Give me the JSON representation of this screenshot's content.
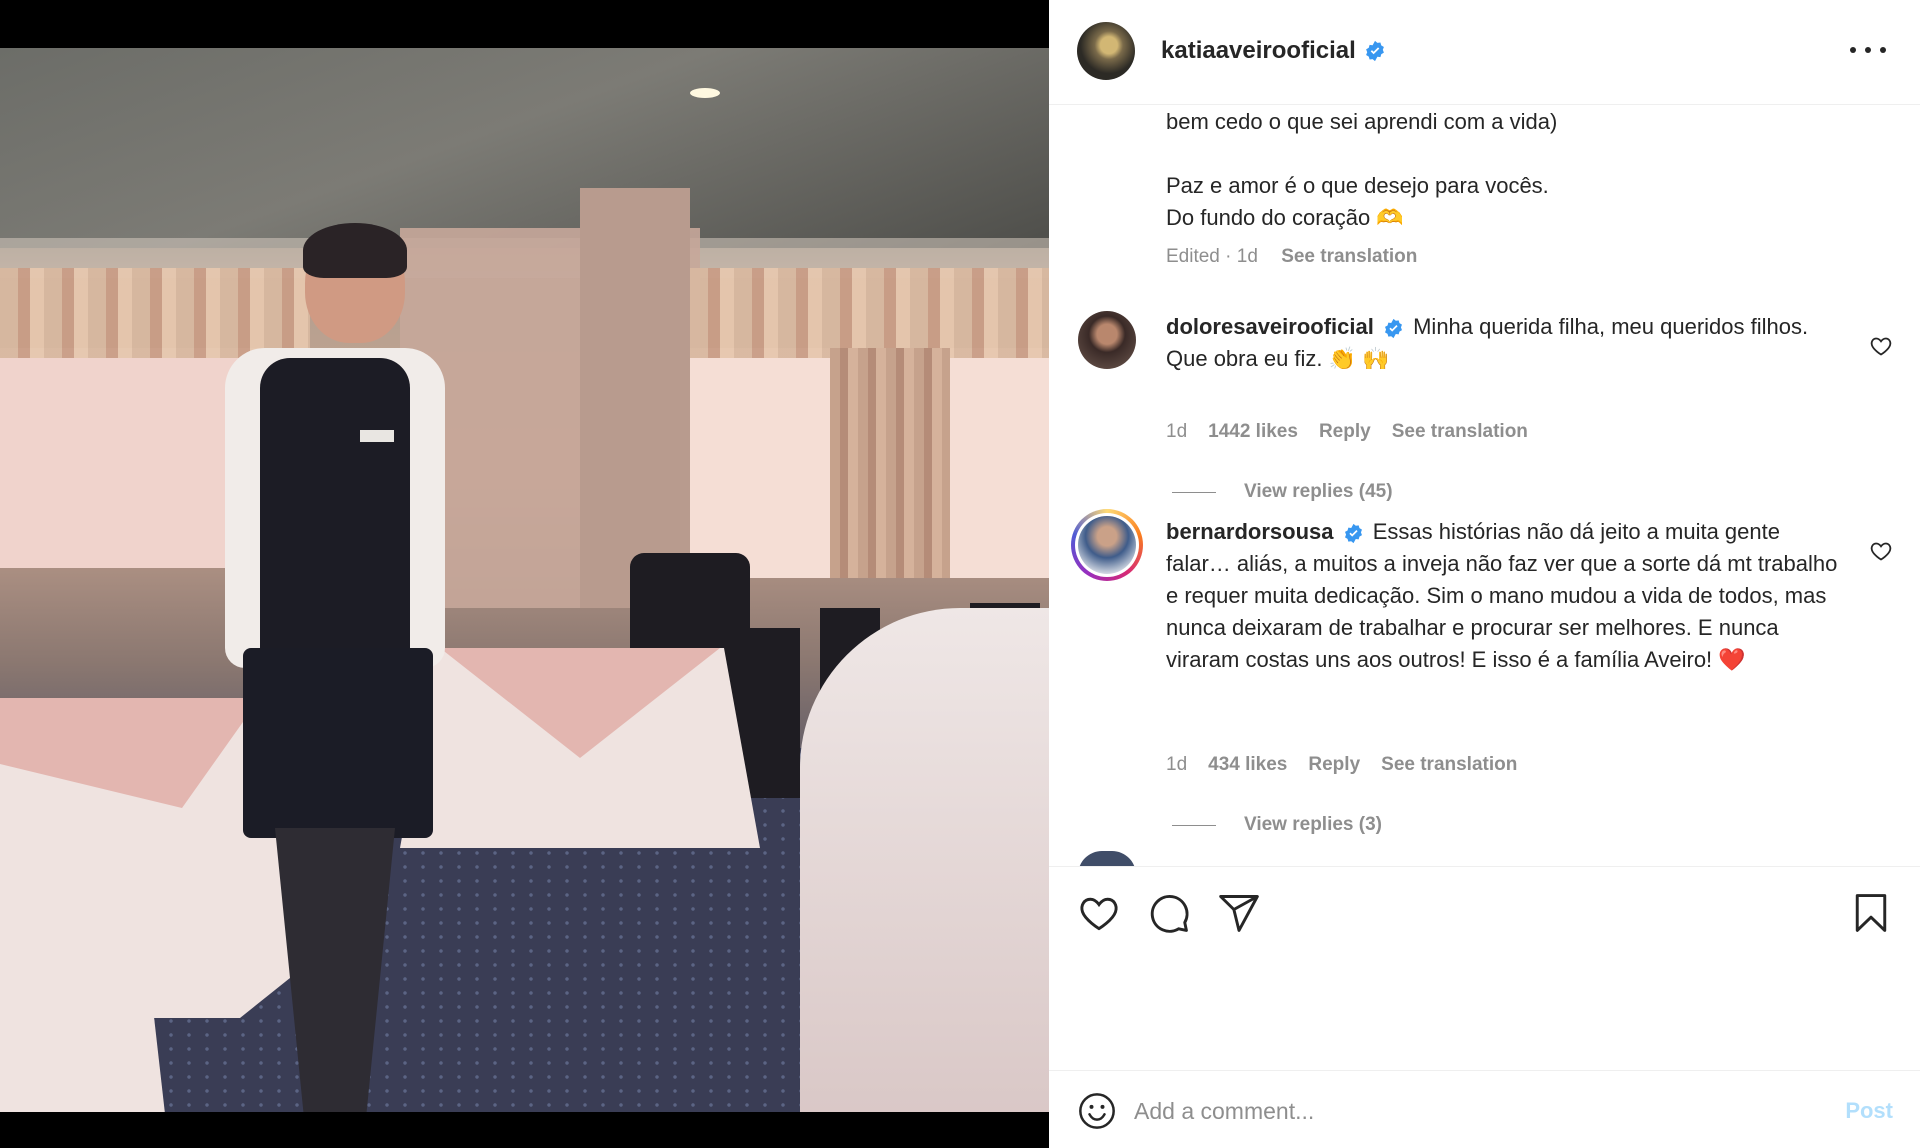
{
  "post": {
    "author": "katiaaveirooficial",
    "caption_lines": [
      "bem cedo o que sei aprendi com a vida)",
      "",
      "Paz e amor é o que desejo para vocês.",
      "Do fundo do coração 🫶"
    ],
    "caption_meta": "Edited · 1d",
    "see_translation": "See translation"
  },
  "comments": [
    {
      "username": "doloresaveirooficial",
      "text": "Minha querida filha, meu queridos filhos. Que obra eu fiz. 👏 🙌",
      "age": "1d",
      "likes": "1442 likes",
      "reply": "Reply",
      "translate": "See translation",
      "view_replies": "View replies (45)"
    },
    {
      "username": "bernardorsousa",
      "text": "Essas histórias não dá jeito a muita gente falar… aliás, a muitos a inveja não faz ver que a sorte dá mt trabalho e requer muita dedicação. Sim o mano mudou a vida de todos, mas nunca deixaram de trabalhar e procurar ser melhores. E nunca viraram costas uns aos outros! E isso é a família Aveiro! ❤️",
      "age": "1d",
      "likes": "434 likes",
      "reply": "Reply",
      "translate": "See translation",
      "view_replies": "View replies (3)"
    }
  ],
  "comment_box": {
    "placeholder": "Add a comment...",
    "post_label": "Post"
  },
  "icons": {
    "verified": "verified-badge-icon",
    "more": "more-options-icon",
    "like": "heart-icon",
    "comment": "comment-icon",
    "share": "share-icon",
    "save": "bookmark-icon",
    "emoji": "emoji-icon"
  },
  "colors": {
    "verified_blue": "#3897f0",
    "post_button_disabled": "#b2dffc",
    "secondary_text": "#8e8e8e"
  }
}
